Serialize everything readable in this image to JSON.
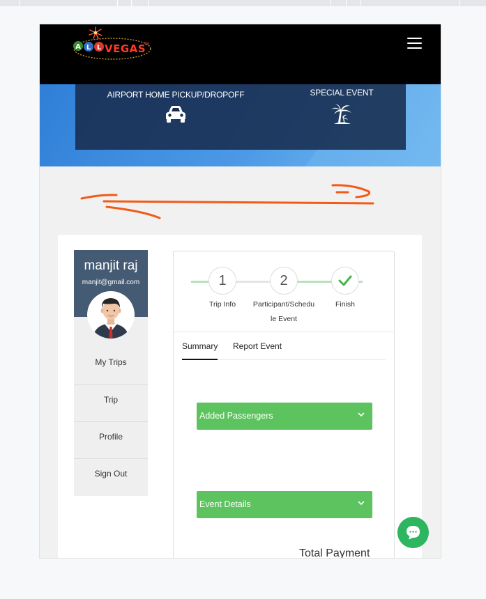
{
  "brand": {
    "logo_text": "ALL VEGAS",
    "logo_mark": "TM"
  },
  "colors": {
    "header_bg": "#000000",
    "profile_header": "#455a73",
    "accent_green": "#5cc35e",
    "annotation": "#f25a16"
  },
  "services": [
    {
      "label": "AIRPORT HOME PICKUP/DROPOFF",
      "icon": "car-icon"
    },
    {
      "label": "SPECIAL EVENT",
      "icon": "palm-tree-icon"
    }
  ],
  "profile": {
    "name": "manjit raj",
    "email": "manjit@gmail.com",
    "menu": [
      "My Trips",
      "Trip",
      "Profile",
      "Sign Out"
    ]
  },
  "steps": [
    {
      "number": "1",
      "label": "Trip Info"
    },
    {
      "number": "2",
      "label_line1": "Participant/Schedu",
      "label_line2": "le Event"
    },
    {
      "label": "Finish",
      "icon": "checkmark-icon"
    }
  ],
  "tabs": [
    "Summary",
    "Report Event"
  ],
  "sections": [
    "Added Passengers",
    "Event Details"
  ],
  "total_label": "Total Payment"
}
